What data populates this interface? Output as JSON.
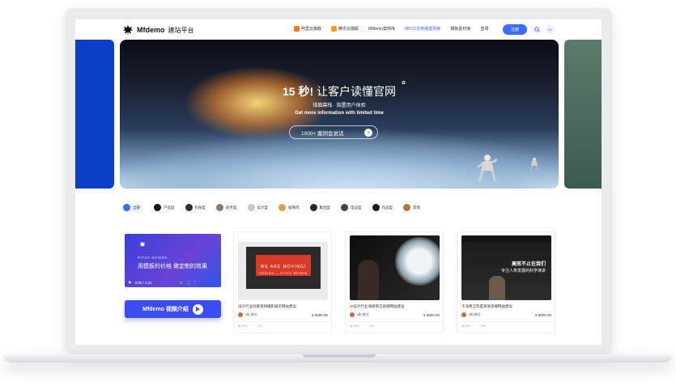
{
  "header": {
    "brand": "Mfdemo",
    "brand_sub": "建站平台",
    "nav": [
      {
        "label": "阿里云旗舰",
        "badge": true
      },
      {
        "label": "腾讯云旗舰",
        "badge": true
      },
      {
        "label": "Mfdemo案例库",
        "badge": false
      },
      {
        "label": "MFCC定制版案例库",
        "badge": false,
        "active": true
      },
      {
        "label": "模板素材库",
        "badge": false
      },
      {
        "label": "登录",
        "badge": false
      }
    ],
    "register": "注册",
    "lang": "En"
  },
  "hero": {
    "title_bold": "15 秒!",
    "title_rest": " 让客户读懂官网",
    "sub1": "指面幕栈 · 指置用户体验",
    "sub2": "Get more information with limited time",
    "cta": "1000+ 案例会说话"
  },
  "categories": [
    {
      "label": "全部",
      "color": "#3b6bff",
      "active": true
    },
    {
      "label": "产品型",
      "color": "#111111"
    },
    {
      "label": "科技型",
      "color": "#3a2a2a"
    },
    {
      "label": "商务型",
      "color": "#8a7a6a"
    },
    {
      "label": "设计型",
      "color": "#c9c9c9"
    },
    {
      "label": "极简风",
      "color": "#d8a04a"
    },
    {
      "label": "集团型",
      "color": "#2a2a2a"
    },
    {
      "label": "电竞型",
      "color": "#444444"
    },
    {
      "label": "作品型",
      "color": "#1a1a1a"
    },
    {
      "label": "其他",
      "color": "#b07a3a"
    }
  ],
  "video_card": {
    "brand": "PITHY MFWEB",
    "title": "用模板的价格  做定制的效果",
    "time": "0:00 / 1:21",
    "button": "Mfdemo 视频介绍"
  },
  "cards": [
    {
      "title": "设计行业创意现场摄影展示网站建设",
      "author": "(新)博业",
      "price": "¥ 6800.00",
      "views": "6980",
      "likes": "134",
      "thumb_text1": "WE ARE MOVING!",
      "thumb_text2": "DESIGN — PITHY·MFWEB"
    },
    {
      "title": "UI设计行业清爽简洁高端网站建设",
      "author": "(新)博业",
      "price": "¥ 6800.00",
      "views": "5002",
      "likes": "190"
    },
    {
      "title": "干净简洁年度演讲高端网站建设",
      "author": "(新)博业",
      "price": "¥ 6800.00",
      "views": "8967",
      "likes": "936",
      "thumb_text1": "高效不止在我们",
      "thumb_text2": "专注人类发展的科学演讲"
    }
  ]
}
